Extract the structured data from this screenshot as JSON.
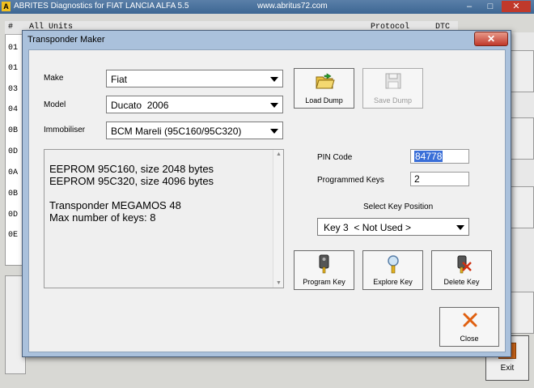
{
  "app": {
    "icon_letter": "A",
    "title": "ABRITES Diagnostics for FIAT LANCIA ALFA 5.5",
    "site": "www.abritus72.com",
    "list_header": {
      "col_hash": "#",
      "col_units": "All Units",
      "col_protocol": "Protocol",
      "col_dtc": "DTC"
    },
    "row_ids": [
      "01",
      "01",
      "03",
      "04",
      "0B",
      "0D",
      "0A",
      "0B",
      "0D",
      "0E"
    ],
    "exit_label": "Exit"
  },
  "dialog": {
    "title": "Transponder Maker",
    "close_glyph": "✕",
    "make": {
      "label": "Make",
      "value": "Fiat"
    },
    "model": {
      "label": "Model",
      "value": "Ducato  2006"
    },
    "immobiliser": {
      "label": "Immobiliser",
      "value": "BCM Mareli (95C160/95C320)"
    },
    "info_lines": [
      "EEPROM 95C160, size 2048 bytes",
      "EEPROM 95C320, size 4096 bytes",
      "",
      "Transponder MEGAMOS 48",
      "Max number of keys: 8"
    ],
    "load_dump": "Load Dump",
    "save_dump": "Save Dump",
    "pin_code": {
      "label": "PIN Code",
      "value": "84778"
    },
    "programmed_keys": {
      "label": "Programmed Keys",
      "value": "2"
    },
    "key_position": {
      "label": "Select Key Position",
      "value": "Key 3  < Not Used >"
    },
    "program_key": "Program Key",
    "explore_key": "Explore Key",
    "delete_key": "Delete Key",
    "close": "Close"
  }
}
